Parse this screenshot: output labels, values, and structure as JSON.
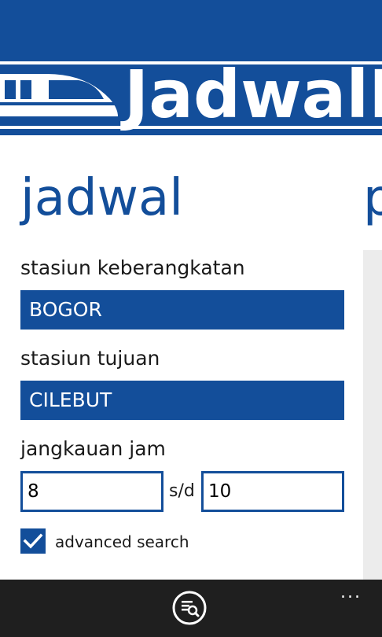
{
  "header": {
    "logo_text": "JadwalKRL",
    "logo_icon": "train-icon"
  },
  "pivot": {
    "title": "jadwal",
    "next_title_peek": "p"
  },
  "form": {
    "departure": {
      "label": "stasiun keberangkatan",
      "value": "BOGOR"
    },
    "destination": {
      "label": "stasiun tujuan",
      "value": "CILEBUT"
    },
    "time_range": {
      "label": "jangkauan jam",
      "from": "8",
      "separator": "s/d",
      "to": "10"
    },
    "advanced": {
      "label": "advanced search",
      "checked": true
    }
  },
  "appbar": {
    "search_icon": "search-schedule-icon",
    "more_label": "..."
  },
  "colors": {
    "accent": "#134e9a",
    "appbar": "#1f1f1f",
    "panel": "#ececec"
  }
}
